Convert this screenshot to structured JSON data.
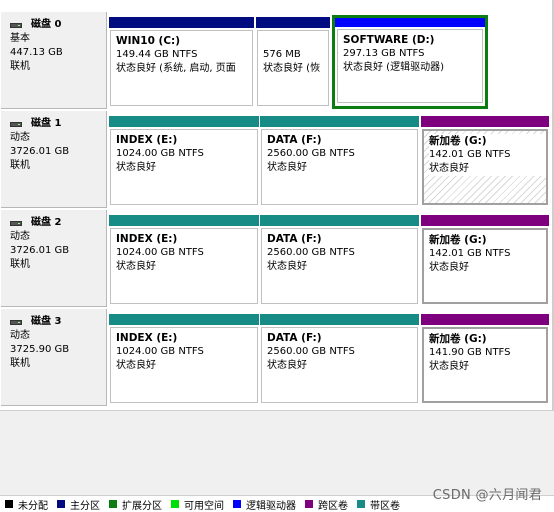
{
  "disks": [
    {
      "title": "磁盘 0",
      "type": "基本",
      "size": "447.13 GB",
      "status": "联机",
      "partitions": [
        {
          "name": "WIN10  (C:)",
          "size": "149.44 GB NTFS",
          "status": "状态良好 (系统, 启动, 页面",
          "kind": "primary"
        },
        {
          "name": "",
          "size": "576 MB",
          "status": "状态良好 (恢",
          "kind": "primary"
        },
        {
          "name": "SOFTWARE  (D:)",
          "size": "297.13 GB NTFS",
          "status": "状态良好 (逻辑驱动器)",
          "kind": "logical"
        }
      ]
    },
    {
      "title": "磁盘 1",
      "type": "动态",
      "size": "3726.01 GB",
      "status": "联机",
      "partitions": [
        {
          "name": "INDEX  (E:)",
          "size": "1024.00 GB NTFS",
          "status": "状态良好",
          "kind": "striped"
        },
        {
          "name": "DATA  (F:)",
          "size": "2560.00 GB NTFS",
          "status": "状态良好",
          "kind": "striped"
        },
        {
          "name": "新加卷  (G:)",
          "size": "142.01 GB NTFS",
          "status": "状态良好",
          "kind": "spanned"
        }
      ]
    },
    {
      "title": "磁盘 2",
      "type": "动态",
      "size": "3726.01 GB",
      "status": "联机",
      "partitions": [
        {
          "name": "INDEX  (E:)",
          "size": "1024.00 GB NTFS",
          "status": "状态良好",
          "kind": "striped"
        },
        {
          "name": "DATA  (F:)",
          "size": "2560.00 GB NTFS",
          "status": "状态良好",
          "kind": "striped"
        },
        {
          "name": "新加卷  (G:)",
          "size": "142.01 GB NTFS",
          "status": "状态良好",
          "kind": "spanned"
        }
      ]
    },
    {
      "title": "磁盘 3",
      "type": "动态",
      "size": "3725.90 GB",
      "status": "联机",
      "partitions": [
        {
          "name": "INDEX  (E:)",
          "size": "1024.00 GB NTFS",
          "status": "状态良好",
          "kind": "striped"
        },
        {
          "name": "DATA  (F:)",
          "size": "2560.00 GB NTFS",
          "status": "状态良好",
          "kind": "striped"
        },
        {
          "name": "新加卷  (G:)",
          "size": "141.90 GB NTFS",
          "status": "状态良好",
          "kind": "spanned"
        }
      ]
    }
  ],
  "legend": [
    {
      "label": "未分配",
      "color": "#000000"
    },
    {
      "label": "主分区",
      "color": "#000c7f"
    },
    {
      "label": "扩展分区",
      "color": "#0c7d12"
    },
    {
      "label": "可用空间",
      "color": "#00e000"
    },
    {
      "label": "逻辑驱动器",
      "color": "#0000ff"
    },
    {
      "label": "跨区卷",
      "color": "#7f007f"
    },
    {
      "label": "带区卷",
      "color": "#178b86"
    }
  ],
  "watermark": "CSDN @六月闻君"
}
